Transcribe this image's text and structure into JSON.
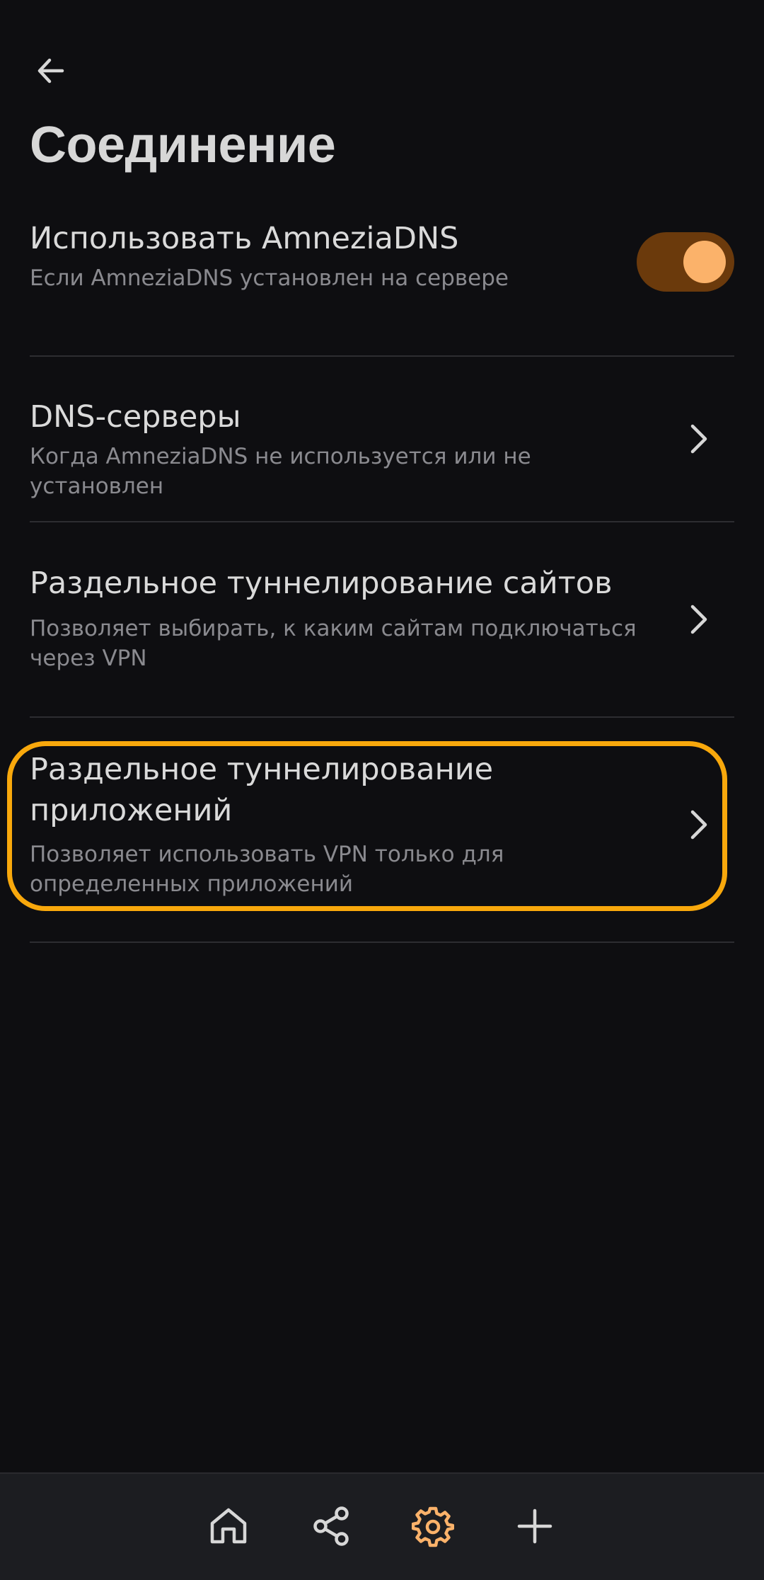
{
  "header": {
    "back_icon": "arrow-left-icon",
    "title": "Соединение"
  },
  "settings": [
    {
      "title": "Использовать AmneziaDNS",
      "subtitle": "Если AmneziaDNS установлен на сервере",
      "control": "toggle",
      "toggle_on": true
    },
    {
      "title": "DNS-серверы",
      "subtitle": "Когда AmneziaDNS не используется или не установлен",
      "control": "chevron"
    },
    {
      "title": "Раздельное туннелирование сайтов",
      "subtitle": "Позволяет выбирать, к каким сайтам подключаться через VPN",
      "control": "chevron"
    },
    {
      "title": "Раздельное туннелирование приложений",
      "subtitle": "Позволяет использовать VPN только для определенных приложений",
      "control": "chevron",
      "highlighted": true
    }
  ],
  "bottom_nav": {
    "items": [
      {
        "icon": "home-icon",
        "active": false
      },
      {
        "icon": "share-icon",
        "active": false
      },
      {
        "icon": "gear-icon",
        "active": true
      },
      {
        "icon": "plus-icon",
        "active": false
      }
    ]
  },
  "colors": {
    "background": "#0e0e11",
    "text_primary": "#d7d7d7",
    "text_secondary": "#8a8a8f",
    "accent": "#fbb26a",
    "toggle_track": "#6b3a0c",
    "highlight_outline": "#f8a80c",
    "divider": "#2d2d31",
    "bottom_bar": "#1c1d21"
  }
}
